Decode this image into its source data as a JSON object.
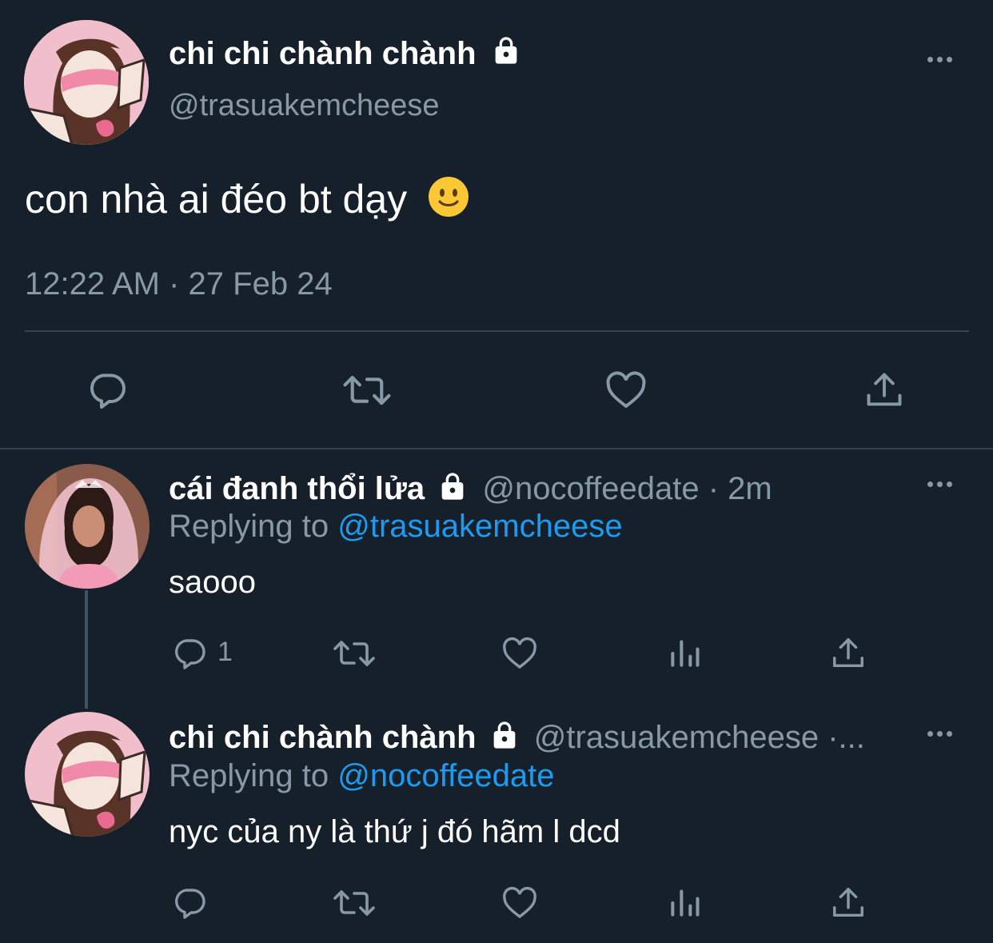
{
  "main_tweet": {
    "display_name": "chi chi chành chành",
    "handle": "@trasuakemcheese",
    "text": "con nhà ai đéo bt dạy",
    "emoji": "🙂",
    "timestamp": "12:22 AM · 27 Feb 24"
  },
  "reply1": {
    "display_name": "cái đanh thổi lửa",
    "handle": "@nocoffeedate",
    "time": "· 2m",
    "replying_label": "Replying to",
    "replying_to": "@trasuakemcheese",
    "text": "saooo",
    "reply_count": "1"
  },
  "reply2": {
    "display_name": "chi chi chành chành",
    "handle": "@trasuakemcheese ·...",
    "replying_label": "Replying to",
    "replying_to": "@nocoffeedate",
    "text": "nyc của ny là thứ j đó hãm l dcd"
  },
  "icons": {
    "lock": "lock-icon",
    "more": "more-icon",
    "reply": "reply-icon",
    "retweet": "retweet-icon",
    "like": "like-icon",
    "share": "share-icon",
    "analytics": "analytics-icon"
  },
  "colors": {
    "background": "#15202b",
    "muted": "#8899a6",
    "link": "#1d9bf0",
    "divider": "#38444d"
  }
}
